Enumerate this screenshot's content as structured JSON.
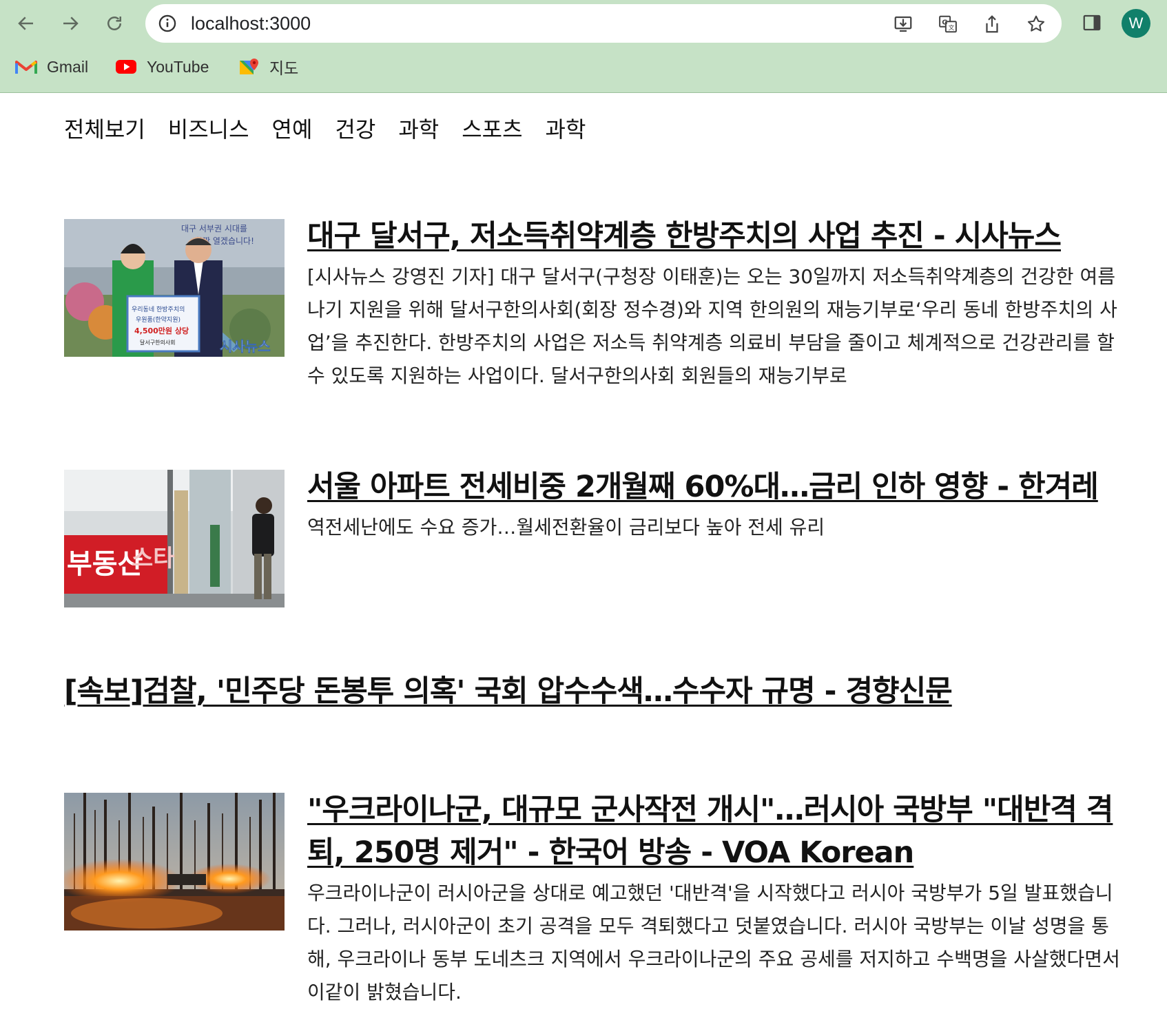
{
  "browser": {
    "url": "localhost:3000",
    "avatar_letter": "W",
    "bookmarks": [
      {
        "label": "Gmail",
        "icon": "gmail-icon"
      },
      {
        "label": "YouTube",
        "icon": "youtube-icon"
      },
      {
        "label": "지도",
        "icon": "maps-icon"
      }
    ]
  },
  "nav": {
    "items": [
      "전체보기",
      "비즈니스",
      "연예",
      "건강",
      "과학",
      "스포츠",
      "과학"
    ]
  },
  "articles": [
    {
      "title": "대구 달서구, 저소득취약계층 한방주치의 사업 추진 - 시사뉴스",
      "description": "[시사뉴스 강영진 기자] 대구 달서구(구청장 이태훈)는 오는 30일까지 저소득취약계층의 건강한 여름나기 지원을 위해 달서구한의사회(회장 정수경)와 지역 한의원의 재능기부로‘우리 동네 한방주치의 사업’을 추진한다. 한방주치의 사업은 저소득 취약계층 의료비 부담을 줄이고 체계적으로 건강관리를 할 수 있도록 지원하는 사업이다. 달서구한의사회 회원들의 재능기부로",
      "thumb_text": [
        "대구 서부권 시대를",
        "활짝 열겠습니다!",
        "우리동네 한방주치의",
        "우원품(한약지원)",
        "4,500만원 상당",
        "달서구한의사회",
        "시사뉴스"
      ]
    },
    {
      "title": "서울 아파트 전세비중 2개월째 60%대…금리 인하 영향 - 한겨레",
      "description": "역전세난에도 수요 증가…월세전환율이 금리보다 높아 전세 유리",
      "thumb_text": [
        "부동산",
        "스타"
      ]
    },
    {
      "title": "[속보]검찰, '민주당 돈봉투 의혹' 국회 압수수색…수수자 규명 - 경향신문",
      "description": ""
    },
    {
      "title": "\"우크라이나군, 대규모 군사작전 개시\"…러시아 국방부 \"대반격 격퇴, 250명 제거\" - 한국어 방송 - VOA Korean",
      "description": "우크라이나군이 러시아군을 상대로 예고했던 '대반격'을 시작했다고 러시아 국방부가 5일 발표했습니다. 그러나, 러시아군이 초기 공격을 모두 격퇴했다고 덧붙였습니다. 러시아 국방부는 이날 성명을 통해, 우크라이나 동부 도네츠크 지역에서 우크라이나군의 주요 공세를 저지하고 수백명을 사살했다면서 이같이 밝혔습니다."
    }
  ]
}
